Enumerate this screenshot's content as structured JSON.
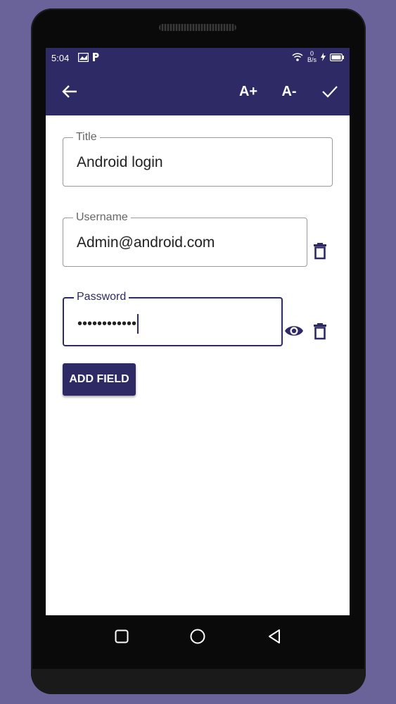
{
  "status": {
    "time": "5:04",
    "net_speed_top": "0",
    "net_speed_unit": "B/s"
  },
  "appbar": {
    "back_icon": "arrow-left-icon",
    "font_increase_label": "A+",
    "font_decrease_label": "A-",
    "save_icon": "check-icon"
  },
  "fields": {
    "title": {
      "label": "Title",
      "value": "Android login"
    },
    "username": {
      "label": "Username",
      "value": "Admin@android.com"
    },
    "password": {
      "label": "Password",
      "masked_value": "••••••••••••"
    }
  },
  "actions": {
    "add_field_label": "ADD FIELD"
  },
  "colors": {
    "primary": "#2e2a65",
    "background": "#6a6399"
  }
}
